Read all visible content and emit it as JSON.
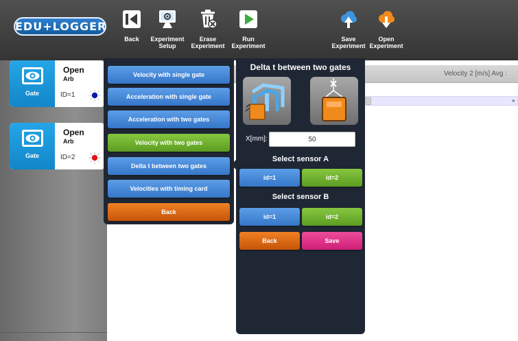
{
  "app": {
    "logo_text": "EDU+LOGGER"
  },
  "toolbar": {
    "back_label": "Back",
    "experiment_setup_label": "Experiment\nSetup",
    "erase_label": "Erase\nExperiment",
    "run_label": "Run\nExperiment",
    "save_label": "Save\nExperiment",
    "open_label": "Open\nExperiment"
  },
  "sensors": [
    {
      "status": "Open",
      "type": "Arb",
      "tile_label": "Gate",
      "id_label": "ID=1",
      "led_color": "#0a1aa8"
    },
    {
      "status": "Open",
      "type": "Arb",
      "tile_label": "Gate",
      "id_label": "ID=2",
      "led_color": "#e0141e"
    }
  ],
  "table": {
    "header_text": "Velocity 2 [m/s] Avg :"
  },
  "experiment_menu": {
    "items": [
      {
        "label": "Velocity with single gate",
        "color": "blue"
      },
      {
        "label": "Acceleration with single gate",
        "color": "blue"
      },
      {
        "label": "Acceleration with two gates",
        "color": "blue"
      },
      {
        "label": "Velocity with two gates",
        "color": "green"
      },
      {
        "label": "Delta t between two gates",
        "color": "blue"
      },
      {
        "label": "Velocities with timing card",
        "color": "blue"
      },
      {
        "label": "Back",
        "color": "orange"
      }
    ]
  },
  "settings": {
    "title": "Delta t between two gates",
    "x_label": "X[mm]:",
    "x_value": "50",
    "sensor_a_title": "Select sensor A",
    "sensor_a_options": [
      "id=1",
      "id=2"
    ],
    "sensor_b_title": "Select sensor B",
    "sensor_b_options": [
      "id=1",
      "id=2"
    ],
    "back_label": "Back",
    "save_label": "Save"
  },
  "colors": {
    "toolbar_bg": "#3c3c3c",
    "panel_bg": "#1f2734",
    "button_blue": "#4a8ad8",
    "button_green": "#6cad2c",
    "button_orange": "#e06818",
    "button_pink": "#e0358a",
    "sensor_tile": "#1a96d8"
  }
}
